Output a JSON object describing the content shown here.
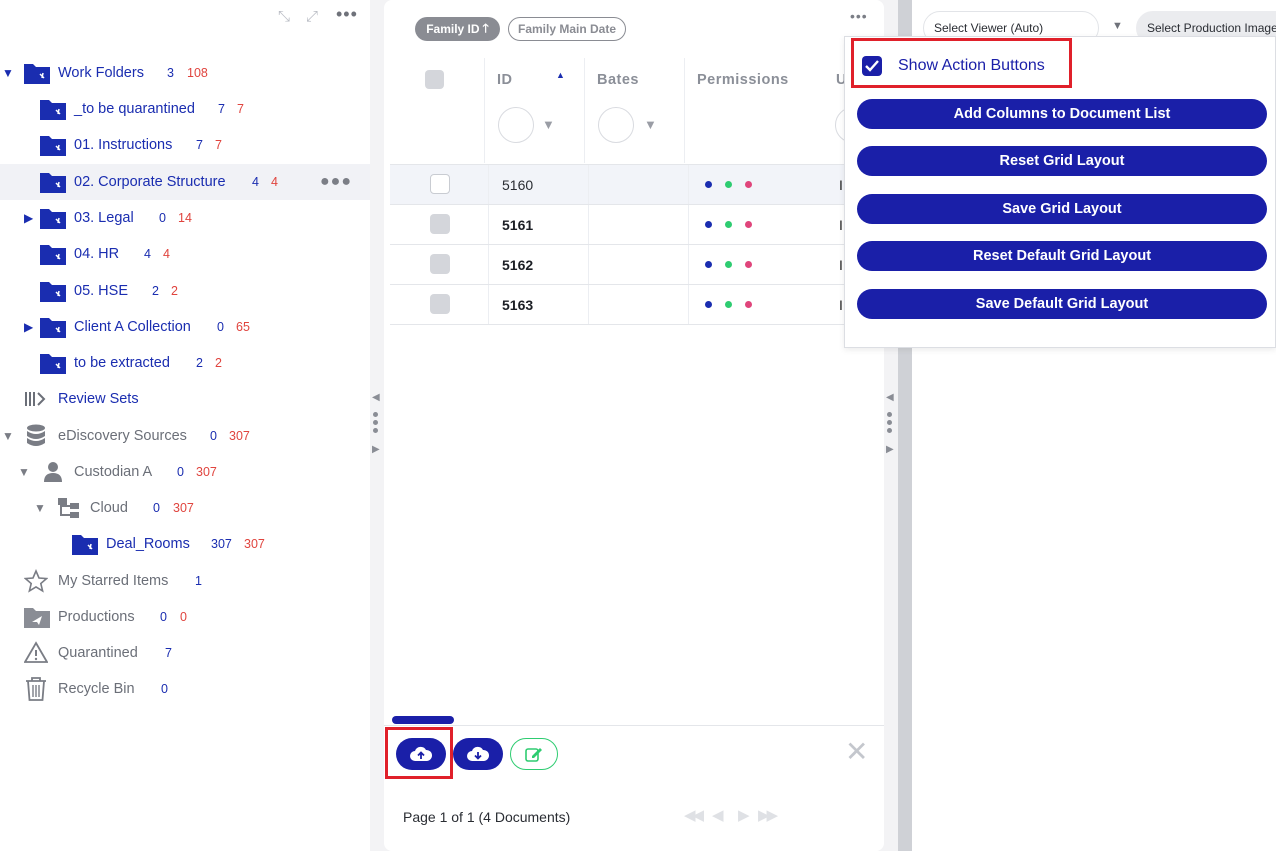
{
  "left_panel": {
    "tree": [
      {
        "label": "Work Folders",
        "count_blue": "3",
        "count_red": "108"
      },
      {
        "label": "_to be quarantined",
        "count_blue": "7",
        "count_red": "7"
      },
      {
        "label": "01. Instructions",
        "count_blue": "7",
        "count_red": "7"
      },
      {
        "label": "02. Corporate Structure",
        "count_blue": "4",
        "count_red": "4"
      },
      {
        "label": "03. Legal",
        "count_blue": "0",
        "count_red": "14"
      },
      {
        "label": "04. HR",
        "count_blue": "4",
        "count_red": "4"
      },
      {
        "label": "05. HSE",
        "count_blue": "2",
        "count_red": "2"
      },
      {
        "label": "Client A Collection",
        "count_blue": "0",
        "count_red": "65"
      },
      {
        "label": "to be extracted",
        "count_blue": "2",
        "count_red": "2"
      },
      {
        "label": "Review Sets"
      },
      {
        "label": "eDiscovery Sources",
        "count_blue": "0",
        "count_red": "307"
      },
      {
        "label": "Custodian A",
        "count_blue": "0",
        "count_red": "307"
      },
      {
        "label": "Cloud",
        "count_blue": "0",
        "count_red": "307"
      },
      {
        "label": "Deal_Rooms",
        "count_blue": "307",
        "count_red": "307"
      },
      {
        "label": "My Starred Items",
        "count_blue": "1"
      },
      {
        "label": "Productions",
        "count_blue": "0",
        "count_red": "0"
      },
      {
        "label": "Quarantined",
        "count_blue": "7"
      },
      {
        "label": "Recycle Bin",
        "count_blue": "0"
      }
    ]
  },
  "grid": {
    "sort_chips": {
      "active": "Family ID",
      "inactive": "Family Main Date"
    },
    "columns": {
      "id": "ID",
      "bates": "Bates",
      "permissions": "Permissions",
      "truncated": "U"
    },
    "rows": [
      {
        "id": "5160",
        "trunc": "I"
      },
      {
        "id": "5161",
        "trunc": "I"
      },
      {
        "id": "5162",
        "trunc": "I"
      },
      {
        "id": "5163",
        "trunc": "I"
      }
    ],
    "permission_colors": [
      "#1a2db0",
      "#2ecc71",
      "#e0457b"
    ],
    "pagination": "Page 1 of 1 (4 Documents)"
  },
  "right_panel": {
    "viewer_select": "Select Viewer (Auto)",
    "production_select": "Select Production Image"
  },
  "dropdown": {
    "checkbox_label": "Show Action Buttons",
    "checked": true,
    "buttons": [
      "Add Columns to Document List",
      "Reset Grid Layout",
      "Save Grid Layout",
      "Reset Default Grid Layout",
      "Save Default Grid Layout"
    ]
  },
  "colors": {
    "brand": "#1a1fa8",
    "accent_red": "#e0443e",
    "highlight": "#e0202a",
    "green": "#2ecc71"
  }
}
